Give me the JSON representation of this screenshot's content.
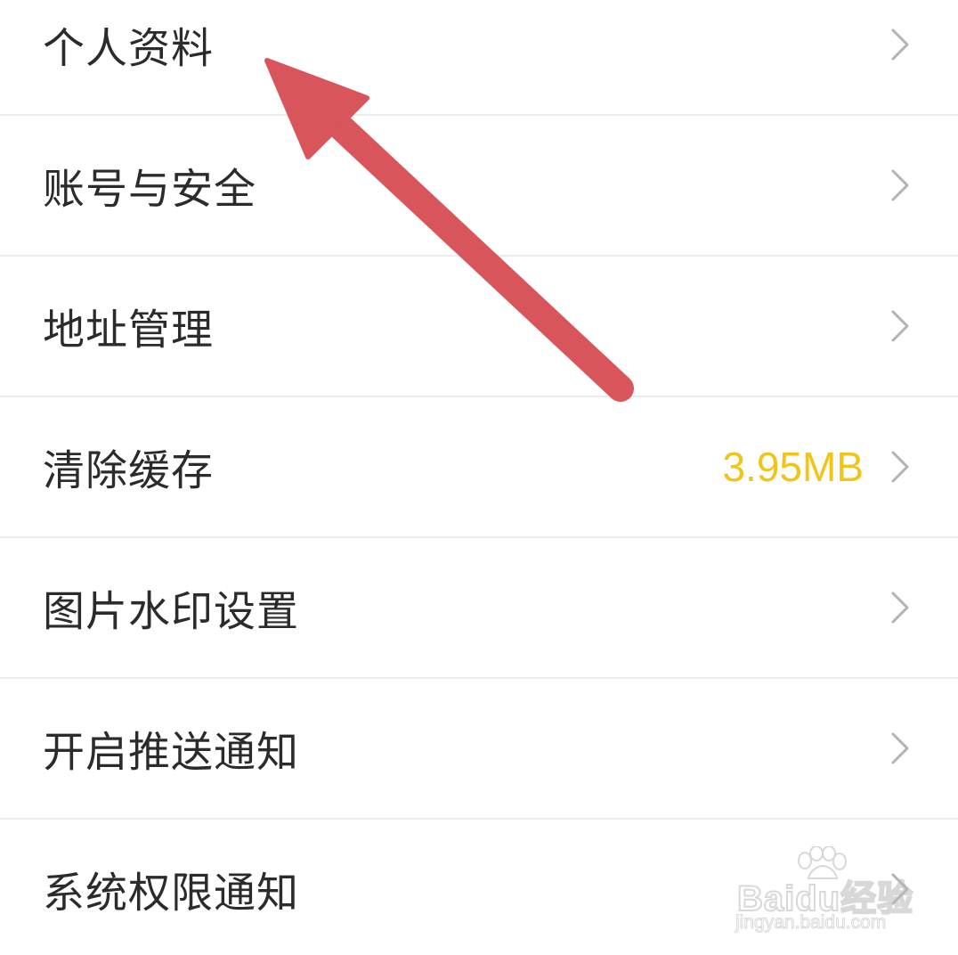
{
  "settings": {
    "items": [
      {
        "label": "个人资料",
        "value": ""
      },
      {
        "label": "账号与安全",
        "value": ""
      },
      {
        "label": "地址管理",
        "value": ""
      },
      {
        "label": "清除缓存",
        "value": "3.95MB"
      },
      {
        "label": "图片水印设置",
        "value": ""
      },
      {
        "label": "开启推送通知",
        "value": ""
      },
      {
        "label": "系统权限通知",
        "value": ""
      }
    ]
  },
  "icons": {
    "row_chevron": "chevron-right-icon",
    "annotation": "red-arrow-annotation"
  },
  "watermark": {
    "brand": "Baidu经验",
    "url": "jingyan.baidu.com"
  },
  "colors": {
    "background": "#ffffff",
    "text": "#2b2b2b",
    "divider": "#ececec",
    "chevron": "#b3b3b3",
    "cache_value": "#f0c419",
    "annotation_arrow": "#d9555c"
  }
}
